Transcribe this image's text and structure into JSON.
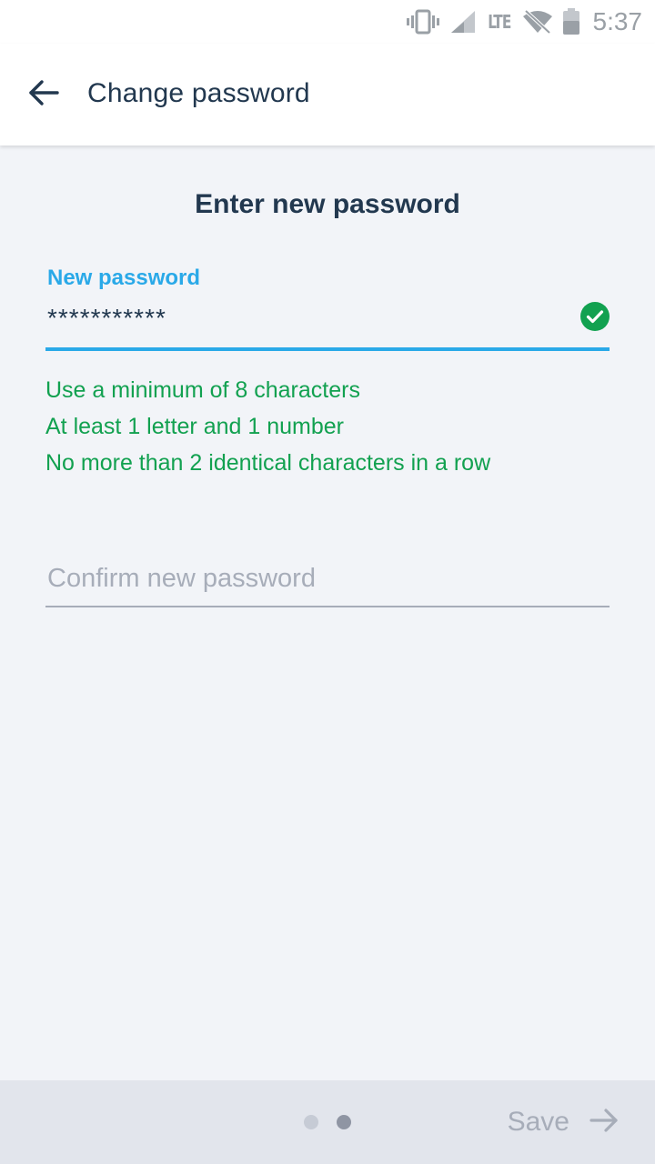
{
  "status_bar": {
    "network": "LTE",
    "time": "5:37",
    "icons": [
      "vibrate-icon",
      "signal-icon",
      "wifi-off-icon",
      "battery-icon"
    ]
  },
  "app_bar": {
    "title": "Change password",
    "back_icon": "arrow-left-icon"
  },
  "main": {
    "heading": "Enter new password",
    "new_password": {
      "label": "New password",
      "value": "***********",
      "valid": true
    },
    "rules": [
      "Use a minimum of 8 characters",
      "At least 1 letter and 1 number",
      "No more than 2 identical characters in a row"
    ],
    "confirm_password": {
      "placeholder": "Confirm new password",
      "value": ""
    }
  },
  "footer": {
    "steps_total": 2,
    "current_step": 2,
    "save_label": "Save",
    "save_icon": "arrow-right-icon"
  },
  "colors": {
    "accent": "#2aa9e8",
    "success": "#12a150",
    "title": "#22384f",
    "disabled": "#a7adb9",
    "background": "#f2f4f8"
  }
}
